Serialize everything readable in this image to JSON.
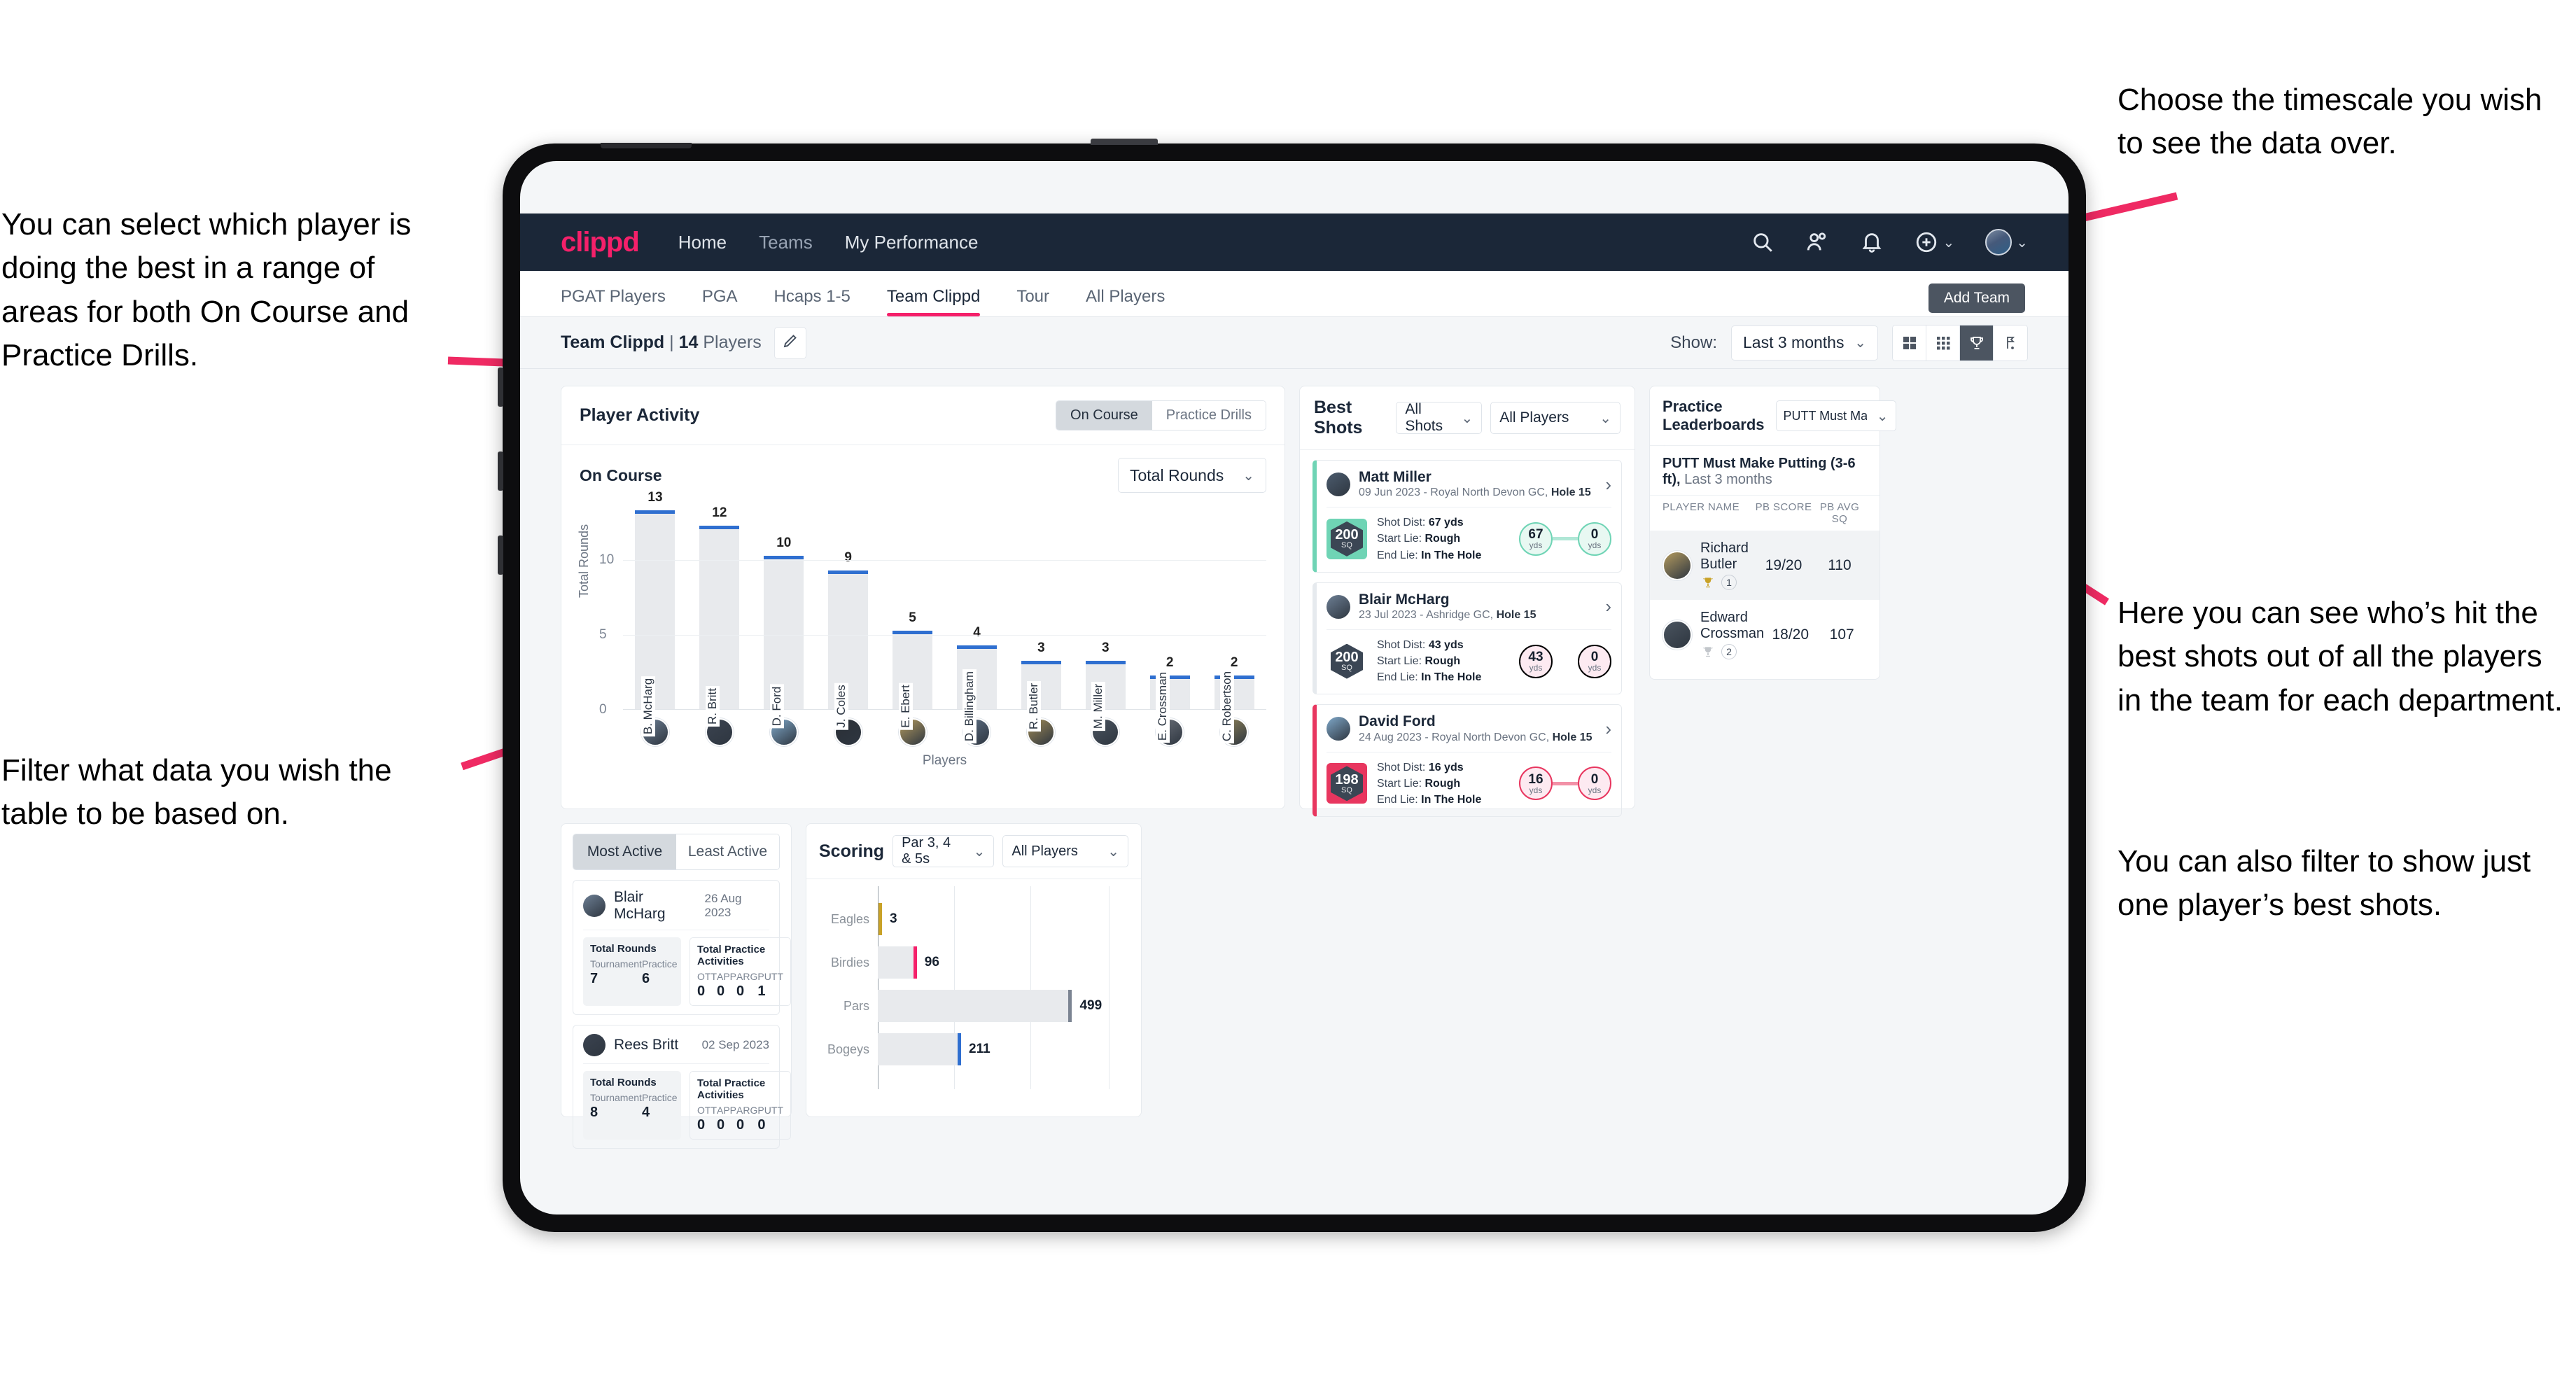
{
  "annotations": [
    {
      "id": "a1",
      "text": "You can select which player is doing the best in a range of areas for both On Course and Practice Drills."
    },
    {
      "id": "a2",
      "text": "Filter what data you wish the table to be based on."
    },
    {
      "id": "a3",
      "text": "Choose the timescale you wish to see the data over."
    },
    {
      "id": "a4",
      "text": "Here you can see who’s hit the best shots out of all the players in the team for each department."
    },
    {
      "id": "a5",
      "text": "You can also filter to show just one player’s best shots."
    }
  ],
  "accent": "#f5206a",
  "topnav": {
    "logo": "clippd",
    "links": [
      {
        "label": "Home"
      },
      {
        "label": "Teams"
      },
      {
        "label": "My Performance"
      }
    ],
    "icons": [
      "search-icon",
      "people-icon",
      "bell-icon",
      "plus-circle-icon",
      "avatar"
    ]
  },
  "tabs": [
    {
      "label": "PGAT Players",
      "active": false
    },
    {
      "label": "PGA",
      "active": false
    },
    {
      "label": "Hcaps 1-5",
      "active": false
    },
    {
      "label": "Team Clippd",
      "active": true
    },
    {
      "label": "Tour",
      "active": false
    },
    {
      "label": "All Players",
      "active": false
    }
  ],
  "add_team_tooltip": "Add Team",
  "toolbar": {
    "team_name": "Team Clippd",
    "separator": "|",
    "player_count": "14",
    "players_word": "Players",
    "edit_icon": "pencil-icon",
    "show_label": "Show:",
    "show_value": "Last 3 months",
    "view_buttons": [
      {
        "name": "grid-large-view",
        "active": false
      },
      {
        "name": "grid-small-view",
        "active": false
      },
      {
        "name": "trophy-view",
        "active": true
      },
      {
        "name": "flag-view",
        "active": false
      }
    ]
  },
  "player_activity": {
    "title": "Player Activity",
    "segments": [
      {
        "label": "On Course",
        "active": true
      },
      {
        "label": "Practice Drills",
        "active": false
      }
    ],
    "sub_label": "On Course",
    "metric_value": "Total Rounds"
  },
  "chart_data": {
    "type": "bar",
    "title": "Player Activity",
    "xlabel": "Players",
    "ylabel": "Total Rounds",
    "ylim": [
      0,
      14
    ],
    "yticks": [
      0,
      5,
      10
    ],
    "grid": true,
    "categories": [
      "B. McHarg",
      "R. Britt",
      "D. Ford",
      "J. Coles",
      "E. Ebert",
      "D. Billingham",
      "R. Butler",
      "M. Miller",
      "E. Crossman",
      "C. Robertson"
    ],
    "values": [
      13,
      12,
      10,
      9,
      5,
      4,
      3,
      3,
      2,
      2
    ]
  },
  "best_shots": {
    "title": "Best Shots",
    "shot_filter": "All Shots",
    "player_filter": "All Players",
    "shots": [
      {
        "name": "Matt Miller",
        "meta_date": "09 Jun 2023 - Royal North Devon GC,",
        "meta_hole": "Hole 15",
        "sq": "200",
        "sq_unit": "SQ",
        "color": "#6fd4b5",
        "shot_dist_label": "Shot Dist:",
        "shot_dist": "67 yds",
        "start_lie_label": "Start Lie:",
        "start_lie": "Rough",
        "end_lie_label": "End Lie:",
        "end_lie": "In The Hole",
        "from_value": "67",
        "from_unit": "yds",
        "to_value": "0",
        "to_unit": "yds"
      },
      {
        "name": "Blair McHarg",
        "meta_date": "23 Jul 2023 - Ashridge GC,",
        "meta_hole": "Hole 15",
        "sq": "200",
        "sq_unit": "SQ",
        "color": "#e8days",
        "shot_dist_label": "Shot Dist:",
        "shot_dist": "43 yds",
        "start_lie_label": "Start Lie:",
        "start_lie": "Rough",
        "end_lie_label": "End Lie:",
        "end_lie": "In The Hole",
        "from_value": "43",
        "from_unit": "yds",
        "to_value": "0",
        "to_unit": "yds"
      },
      {
        "name": "David Ford",
        "meta_date": "24 Aug 2023 - Royal North Devon GC,",
        "meta_hole": "Hole 15",
        "sq": "198",
        "sq_unit": "SQ",
        "color": "#e8365f",
        "shot_dist_label": "Shot Dist:",
        "shot_dist": "16 yds",
        "start_lie_label": "Start Lie:",
        "start_lie": "Rough",
        "end_lie_label": "End Lie:",
        "end_lie": "In The Hole",
        "from_value": "16",
        "from_unit": "yds",
        "to_value": "0",
        "to_unit": "yds"
      }
    ]
  },
  "practice_leaderboards": {
    "title": "Practice Leaderboards",
    "drill_value": "PUTT Must Make Putting ...",
    "drill_title": "PUTT Must Make Putting (3-6 ft),",
    "drill_period": "Last 3 months",
    "columns": [
      "PLAYER NAME",
      "PB SCORE",
      "PB AVG SQ"
    ],
    "rows": [
      {
        "name": "Richard Butler",
        "rank": "1",
        "pb_score": "19/20",
        "pb_avg_sq": "110",
        "trophy": "gold"
      },
      {
        "name": "Edward Crossman",
        "rank": "2",
        "pb_score": "18/20",
        "pb_avg_sq": "107",
        "trophy": "silver"
      }
    ]
  },
  "activity_panel": {
    "tabs": [
      {
        "label": "Most Active",
        "active": true
      },
      {
        "label": "Least Active",
        "active": false
      }
    ],
    "cards": [
      {
        "name": "Blair McHarg",
        "date": "26 Aug 2023",
        "rounds_title": "Total Rounds",
        "rounds": [
          {
            "key": "Tournament",
            "value": "7"
          },
          {
            "key": "Practice",
            "value": "6"
          }
        ],
        "practice_title": "Total Practice Activities",
        "practice": [
          {
            "key": "OTT",
            "value": "0"
          },
          {
            "key": "APP",
            "value": "0"
          },
          {
            "key": "ARG",
            "value": "0"
          },
          {
            "key": "PUTT",
            "value": "1"
          }
        ]
      },
      {
        "name": "Rees Britt",
        "date": "02 Sep 2023",
        "rounds_title": "Total Rounds",
        "rounds": [
          {
            "key": "Tournament",
            "value": "8"
          },
          {
            "key": "Practice",
            "value": "4"
          }
        ],
        "practice_title": "Total Practice Activities",
        "practice": [
          {
            "key": "OTT",
            "value": "0"
          },
          {
            "key": "APP",
            "value": "0"
          },
          {
            "key": "ARG",
            "value": "0"
          },
          {
            "key": "PUTT",
            "value": "0"
          }
        ]
      }
    ]
  },
  "scoring": {
    "title": "Scoring",
    "par_filter": "Par 3, 4 & 5s",
    "player_filter": "All Players"
  },
  "scoring_chart": {
    "type": "bar",
    "orientation": "horizontal",
    "title": "Scoring",
    "categories": [
      "Eagles",
      "Birdies",
      "Pars",
      "Bogeys"
    ],
    "values": [
      3,
      96,
      499,
      211
    ],
    "colors": [
      "#c9a227",
      "#f5206a",
      "#7b8492",
      "#2f6fd0"
    ],
    "xlim": [
      0,
      600
    ],
    "grid": true
  }
}
